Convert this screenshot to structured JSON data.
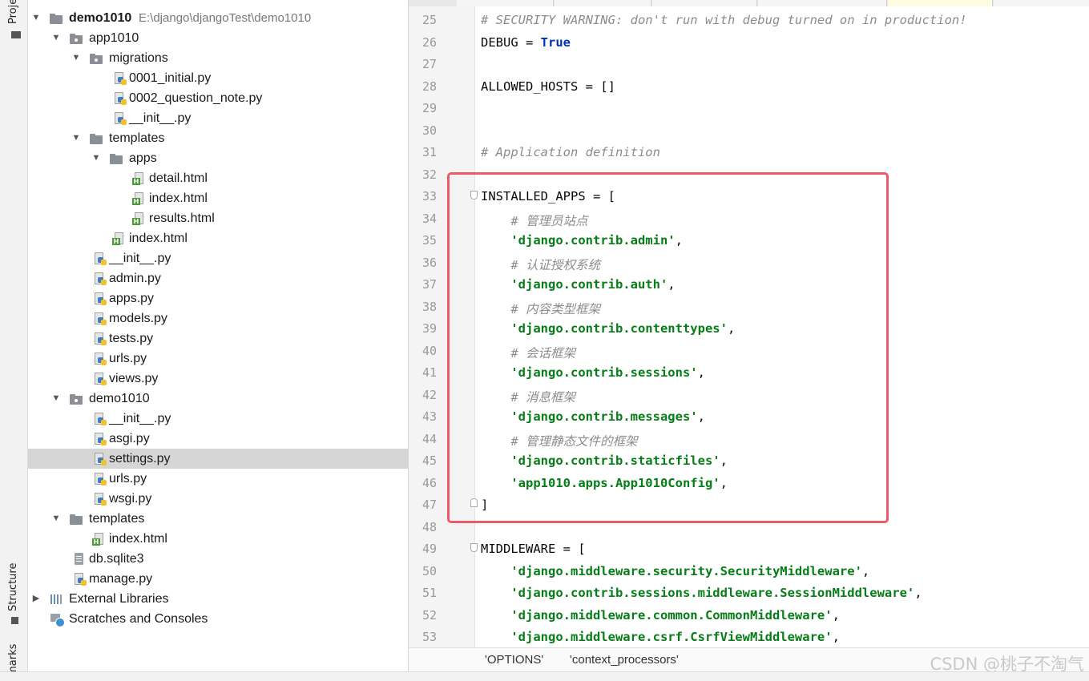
{
  "sidebar": {
    "project_tab": "Proje",
    "structure_tab": "Structure",
    "bookmarks_tab": "rmarks"
  },
  "tree": {
    "rows": [
      {
        "label": "demo1010",
        "path": "E:\\django\\djangoTest\\demo1010",
        "bold": true
      },
      {
        "label": "app1010"
      },
      {
        "label": "migrations"
      },
      {
        "label": "0001_initial.py"
      },
      {
        "label": "0002_question_note.py"
      },
      {
        "label": "__init__.py"
      },
      {
        "label": "templates"
      },
      {
        "label": "apps"
      },
      {
        "label": "detail.html"
      },
      {
        "label": "index.html"
      },
      {
        "label": "results.html"
      },
      {
        "label": "index.html"
      },
      {
        "label": "__init__.py"
      },
      {
        "label": "admin.py"
      },
      {
        "label": "apps.py"
      },
      {
        "label": "models.py"
      },
      {
        "label": "tests.py"
      },
      {
        "label": "urls.py"
      },
      {
        "label": "views.py"
      },
      {
        "label": "demo1010"
      },
      {
        "label": "__init__.py"
      },
      {
        "label": "asgi.py"
      },
      {
        "label": "settings.py",
        "selected": true
      },
      {
        "label": "urls.py"
      },
      {
        "label": "wsgi.py"
      },
      {
        "label": "templates"
      },
      {
        "label": "index.html"
      },
      {
        "label": "db.sqlite3"
      },
      {
        "label": "manage.py"
      },
      {
        "label": "External Libraries"
      },
      {
        "label": "Scratches and Consoles"
      }
    ]
  },
  "editor": {
    "lines": [
      {
        "n": "25",
        "parts": [
          {
            "c": "cm",
            "t": "# SECURITY WARNING: don't run with debug turned on in production!"
          }
        ]
      },
      {
        "n": "26",
        "parts": [
          {
            "c": "",
            "t": "DEBUG = "
          },
          {
            "c": "kw",
            "t": "True"
          }
        ]
      },
      {
        "n": "27",
        "parts": []
      },
      {
        "n": "28",
        "parts": [
          {
            "c": "",
            "t": "ALLOWED_HOSTS = []"
          }
        ]
      },
      {
        "n": "29",
        "parts": []
      },
      {
        "n": "30",
        "parts": []
      },
      {
        "n": "31",
        "parts": [
          {
            "c": "cm",
            "t": "# Application definition"
          }
        ]
      },
      {
        "n": "32",
        "parts": []
      },
      {
        "n": "33",
        "parts": [
          {
            "c": "",
            "t": "INSTALLED_APPS = ["
          }
        ]
      },
      {
        "n": "34",
        "parts": [
          {
            "c": "cm",
            "t": "    # 管理员站点"
          }
        ]
      },
      {
        "n": "35",
        "parts": [
          {
            "c": "st",
            "t": "    'django.contrib.admin'"
          },
          {
            "c": "",
            "t": ","
          }
        ]
      },
      {
        "n": "36",
        "parts": [
          {
            "c": "cm",
            "t": "    # 认证授权系统"
          }
        ]
      },
      {
        "n": "37",
        "parts": [
          {
            "c": "st",
            "t": "    'django.contrib.auth'"
          },
          {
            "c": "",
            "t": ","
          }
        ]
      },
      {
        "n": "38",
        "parts": [
          {
            "c": "cm",
            "t": "    # 内容类型框架"
          }
        ]
      },
      {
        "n": "39",
        "parts": [
          {
            "c": "st",
            "t": "    'django.contrib.contenttypes'"
          },
          {
            "c": "",
            "t": ","
          }
        ]
      },
      {
        "n": "40",
        "parts": [
          {
            "c": "cm",
            "t": "    # 会话框架"
          }
        ]
      },
      {
        "n": "41",
        "parts": [
          {
            "c": "st",
            "t": "    'django.contrib.sessions'"
          },
          {
            "c": "",
            "t": ","
          }
        ]
      },
      {
        "n": "42",
        "parts": [
          {
            "c": "cm",
            "t": "    # 消息框架"
          }
        ]
      },
      {
        "n": "43",
        "parts": [
          {
            "c": "st",
            "t": "    'django.contrib.messages'"
          },
          {
            "c": "",
            "t": ","
          }
        ]
      },
      {
        "n": "44",
        "parts": [
          {
            "c": "cm",
            "t": "    # 管理静态文件的框架"
          }
        ]
      },
      {
        "n": "45",
        "parts": [
          {
            "c": "st",
            "t": "    'django.contrib.staticfiles'"
          },
          {
            "c": "",
            "t": ","
          }
        ]
      },
      {
        "n": "46",
        "parts": [
          {
            "c": "st",
            "t": "    'app1010.apps.App1010Config'"
          },
          {
            "c": "",
            "t": ","
          }
        ]
      },
      {
        "n": "47",
        "parts": [
          {
            "c": "",
            "t": "]"
          }
        ]
      },
      {
        "n": "48",
        "parts": []
      },
      {
        "n": "49",
        "parts": [
          {
            "c": "",
            "t": "MIDDLEWARE = ["
          }
        ]
      },
      {
        "n": "50",
        "parts": [
          {
            "c": "st",
            "t": "    'django.middleware.security.SecurityMiddleware'"
          },
          {
            "c": "",
            "t": ","
          }
        ]
      },
      {
        "n": "51",
        "parts": [
          {
            "c": "st",
            "t": "    'django.contrib.sessions.middleware.SessionMiddleware'"
          },
          {
            "c": "",
            "t": ","
          }
        ]
      },
      {
        "n": "52",
        "parts": [
          {
            "c": "st",
            "t": "    'django.middleware.common.CommonMiddleware'"
          },
          {
            "c": "",
            "t": ","
          }
        ]
      },
      {
        "n": "53",
        "parts": [
          {
            "c": "st",
            "t": "    'django.middleware.csrf.CsrfViewMiddleware'"
          },
          {
            "c": "",
            "t": ","
          }
        ]
      }
    ]
  },
  "breadcrumb": {
    "items": [
      "'OPTIONS'",
      "'context_processors'"
    ]
  },
  "watermark": "CSDN @桃子不淘气",
  "colors": {
    "highlight_box": "#ee5a6a",
    "string": "#067d17",
    "keyword": "#0033b3",
    "comment": "#8c8c8c",
    "selection": "#d6d6d6"
  }
}
